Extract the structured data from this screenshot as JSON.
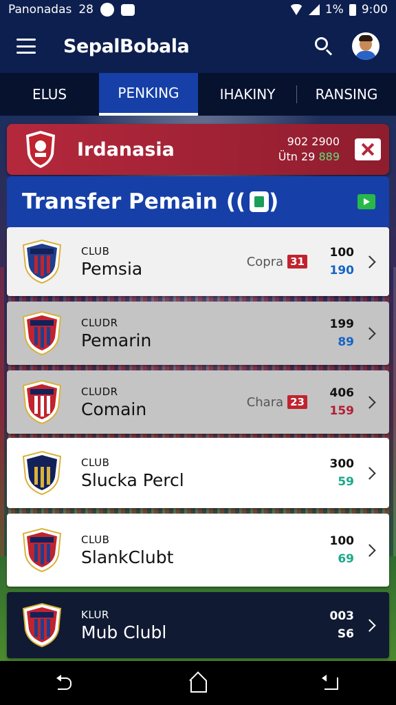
{
  "status_bar": {
    "carrier": "Panonadas",
    "time_left": "28",
    "battery": "1%",
    "time": "9:00"
  },
  "app_bar": {
    "title": "SepalBobala"
  },
  "tabs": [
    {
      "label": "ELUS"
    },
    {
      "label": "PENKING"
    },
    {
      "label": "IHAKINY"
    },
    {
      "label": "RANSING"
    }
  ],
  "league": {
    "name": "Irdanasia",
    "stat_line1": "902  2900",
    "stat_line2_prefix": "Ütn 29",
    "stat_line2_value": "889"
  },
  "transfer": {
    "title": "Transfer Pemain",
    "paren_open": "((",
    "paren_close": ")"
  },
  "clubs": [
    {
      "label": "CLUB",
      "name": "Pemsia",
      "extra_text": "Copra",
      "extra_pill": "31",
      "num_top": "100",
      "num_bottom": "190",
      "bottom_color": "#1664c6",
      "crest_colors": [
        "#1f3f8e",
        "#c0242e"
      ]
    },
    {
      "label": "CLUDR",
      "name": "Pemarin",
      "num_top": "199",
      "num_bottom": "89",
      "bottom_color": "#1664c6",
      "crest_colors": [
        "#c0242e",
        "#1f3f8e"
      ]
    },
    {
      "label": "CLUDR",
      "name": "Comain",
      "extra_text": "Chara",
      "extra_pill": "23",
      "num_top": "406",
      "num_bottom": "159",
      "bottom_color": "#b21f35",
      "crest_colors": [
        "#c0242e",
        "#ffffff"
      ]
    },
    {
      "label": "CLUB",
      "name": "Slucka Percl",
      "num_top": "300",
      "num_bottom": "59",
      "bottom_color": "#1aa98a",
      "crest_colors": [
        "#13215a",
        "#d9b23a"
      ]
    },
    {
      "label": "CLUB",
      "name": "SlankClubt",
      "num_top": "100",
      "num_bottom": "69",
      "bottom_color": "#1aa98a",
      "crest_colors": [
        "#c0242e",
        "#1f3f8e"
      ]
    },
    {
      "label": "KLUR",
      "name": "Mub Clubl",
      "num_top": "003",
      "num_bottom": "S6",
      "bottom_color": "#ffffff",
      "crest_colors": [
        "#c0242e",
        "#1f3f8e"
      ]
    }
  ]
}
